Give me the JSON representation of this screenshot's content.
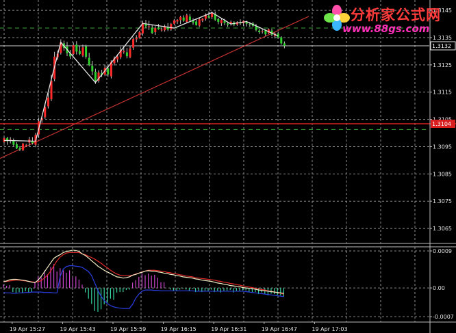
{
  "logo": {
    "name": "分析家公式网",
    "url": "www.88gs.com"
  },
  "chart_data": [
    {
      "type": "candlestick",
      "colors": {
        "up": "#ff2a2a",
        "down": "#2fd12f",
        "wick": "#c9c9c9",
        "grid": "#8c8c8c",
        "background": "#000000"
      },
      "grid": true,
      "y_ticks": [
        "1.3145",
        "1.3135",
        "1.3125",
        "1.3115",
        "1.3105",
        "1.3095",
        "1.3085",
        "1.3075",
        "1.3065"
      ],
      "ylim": [
        1.30595,
        1.31488
      ],
      "current_price_label": "1.3132",
      "current_price": 1.3132,
      "level_label": "1.3104",
      "level_price": 1.31034,
      "dashed_levels": [
        1.31385,
        1.31013
      ],
      "horizontal_lines": [
        1.3132
      ],
      "trend_line": {
        "from": [
          0,
          1.30912
        ],
        "to": [
          95,
          1.31418
        ],
        "color": "#c03030"
      },
      "zigzag": {
        "color": "#e6e6e6",
        "points": [
          [
            0,
            1.30973
          ],
          [
            10,
            1.3097
          ],
          [
            18,
            1.31333
          ],
          [
            29,
            1.31185
          ],
          [
            44,
            1.31402
          ],
          [
            54,
            1.31385
          ],
          [
            66,
            1.31442
          ],
          [
            72,
            1.314
          ],
          [
            77,
            1.31409
          ],
          [
            87,
            1.31356
          ]
        ]
      },
      "time_labels": [
        "19 Apr 15:27",
        "19 Apr 15:43",
        "19 Apr 15:59",
        "19 Apr 16:15",
        "19 Apr 16:31",
        "19 Apr 16:47",
        "19 Apr 17:03"
      ],
      "time_label_index": [
        3,
        19,
        35,
        51,
        67,
        83,
        99
      ],
      "candles": [
        [
          1.30967,
          1.30987,
          1.30962,
          1.30981
        ],
        [
          1.30982,
          1.30986,
          1.30957,
          1.3097
        ],
        [
          1.30971,
          1.30985,
          1.30962,
          1.30976
        ],
        [
          1.30972,
          1.3098,
          1.30952,
          1.30957
        ],
        [
          1.30959,
          1.30966,
          1.30941,
          1.30944
        ],
        [
          1.30945,
          1.30952,
          1.30934,
          1.30939
        ],
        [
          1.30937,
          1.30964,
          1.30934,
          1.30961
        ],
        [
          1.30952,
          1.3096,
          1.30949,
          1.30955
        ],
        [
          1.30965,
          1.30986,
          1.30953,
          1.30976
        ],
        [
          1.3097,
          1.30985,
          1.30958,
          1.30963
        ],
        [
          1.30957,
          1.31,
          1.30948,
          1.30993
        ],
        [
          1.30995,
          1.31057,
          1.30982,
          1.31043
        ],
        [
          1.31047,
          1.31062,
          1.31037,
          1.31054
        ],
        [
          1.31058,
          1.31109,
          1.31052,
          1.31095
        ],
        [
          1.31098,
          1.31147,
          1.3109,
          1.3113
        ],
        [
          1.31124,
          1.31214,
          1.31117,
          1.31192
        ],
        [
          1.31198,
          1.31298,
          1.3119,
          1.3128
        ],
        [
          1.31278,
          1.31303,
          1.31268,
          1.31291
        ],
        [
          1.31294,
          1.31344,
          1.31288,
          1.31333
        ],
        [
          1.31329,
          1.31339,
          1.31302,
          1.31312
        ],
        [
          1.31317,
          1.31334,
          1.31282,
          1.31293
        ],
        [
          1.31292,
          1.31305,
          1.31272,
          1.31281
        ],
        [
          1.3129,
          1.31332,
          1.31285,
          1.31322
        ],
        [
          1.31324,
          1.31337,
          1.31288,
          1.31299
        ],
        [
          1.31301,
          1.31321,
          1.31286,
          1.3129
        ],
        [
          1.31284,
          1.31324,
          1.31279,
          1.31314
        ],
        [
          1.31318,
          1.31324,
          1.31273,
          1.3128
        ],
        [
          1.31276,
          1.31294,
          1.31245,
          1.31249
        ],
        [
          1.31247,
          1.31265,
          1.31212,
          1.31226
        ],
        [
          1.31225,
          1.31236,
          1.3118,
          1.31192
        ],
        [
          1.31192,
          1.3123,
          1.31185,
          1.31222
        ],
        [
          1.3122,
          1.31232,
          1.31205,
          1.31213
        ],
        [
          1.31214,
          1.31251,
          1.31209,
          1.31239
        ],
        [
          1.31237,
          1.31248,
          1.31206,
          1.31215
        ],
        [
          1.31208,
          1.31267,
          1.312,
          1.31261
        ],
        [
          1.31256,
          1.31281,
          1.31248,
          1.31274
        ],
        [
          1.3127,
          1.31289,
          1.31259,
          1.31281
        ],
        [
          1.31278,
          1.31316,
          1.31271,
          1.31305
        ],
        [
          1.31297,
          1.3132,
          1.31291,
          1.31301
        ],
        [
          1.31296,
          1.31312,
          1.31274,
          1.31282
        ],
        [
          1.31278,
          1.3132,
          1.31274,
          1.3131
        ],
        [
          1.31313,
          1.3135,
          1.31305,
          1.31345
        ],
        [
          1.31344,
          1.31359,
          1.31333,
          1.31349
        ],
        [
          1.31349,
          1.31375,
          1.31346,
          1.3137
        ],
        [
          1.31365,
          1.31412,
          1.31357,
          1.31404
        ],
        [
          1.31402,
          1.31415,
          1.31385,
          1.31392
        ],
        [
          1.31388,
          1.31412,
          1.31378,
          1.31391
        ],
        [
          1.31386,
          1.31398,
          1.31363,
          1.31367
        ],
        [
          1.3137,
          1.31392,
          1.3136,
          1.31385
        ],
        [
          1.31387,
          1.314,
          1.31379,
          1.31381
        ],
        [
          1.31378,
          1.31387,
          1.31372,
          1.31379
        ],
        [
          1.31377,
          1.31398,
          1.31372,
          1.31392
        ],
        [
          1.31388,
          1.31403,
          1.31374,
          1.3138
        ],
        [
          1.31381,
          1.31404,
          1.31375,
          1.314
        ],
        [
          1.31401,
          1.31418,
          1.31396,
          1.31413
        ],
        [
          1.31409,
          1.31418,
          1.314,
          1.31415
        ],
        [
          1.31414,
          1.3143,
          1.314,
          1.31426
        ],
        [
          1.31424,
          1.31432,
          1.31408,
          1.31412
        ],
        [
          1.31408,
          1.31438,
          1.31404,
          1.31432
        ],
        [
          1.31427,
          1.31437,
          1.31409,
          1.31414
        ],
        [
          1.31413,
          1.31421,
          1.31397,
          1.31405
        ],
        [
          1.31409,
          1.31418,
          1.31394,
          1.31396
        ],
        [
          1.31394,
          1.31422,
          1.31389,
          1.31417
        ],
        [
          1.31413,
          1.31422,
          1.31407,
          1.31419
        ],
        [
          1.31419,
          1.31439,
          1.31412,
          1.31434
        ],
        [
          1.3143,
          1.31446,
          1.3142,
          1.31424
        ],
        [
          1.31425,
          1.31446,
          1.31418,
          1.3144
        ],
        [
          1.31437,
          1.31446,
          1.31411,
          1.31416
        ],
        [
          1.31418,
          1.31423,
          1.31399,
          1.31408
        ],
        [
          1.31403,
          1.3142,
          1.31393,
          1.31415
        ],
        [
          1.31411,
          1.31419,
          1.31396,
          1.31404
        ],
        [
          1.31402,
          1.31407,
          1.31389,
          1.31397
        ],
        [
          1.31401,
          1.31413,
          1.31394,
          1.31408
        ],
        [
          1.31406,
          1.3141,
          1.31392,
          1.31398
        ],
        [
          1.31398,
          1.3141,
          1.31393,
          1.31407
        ],
        [
          1.31406,
          1.31417,
          1.31396,
          1.31402
        ],
        [
          1.31403,
          1.31414,
          1.31393,
          1.31411
        ],
        [
          1.31407,
          1.31412,
          1.31391,
          1.31401
        ],
        [
          1.314,
          1.31407,
          1.3139,
          1.31399
        ],
        [
          1.31402,
          1.31408,
          1.31389,
          1.31393
        ],
        [
          1.31392,
          1.314,
          1.31373,
          1.31378
        ],
        [
          1.31376,
          1.31382,
          1.31363,
          1.3137
        ],
        [
          1.31373,
          1.31383,
          1.31365,
          1.31374
        ],
        [
          1.31377,
          1.3138,
          1.31356,
          1.31362
        ],
        [
          1.31367,
          1.31384,
          1.31363,
          1.3138
        ],
        [
          1.31376,
          1.31382,
          1.31355,
          1.31361
        ],
        [
          1.31356,
          1.31369,
          1.31347,
          1.31364
        ],
        [
          1.31365,
          1.31372,
          1.31346,
          1.3135
        ],
        [
          1.31351,
          1.31355,
          1.31324,
          1.31329
        ],
        [
          1.31329,
          1.31336,
          1.31311,
          1.3132
        ]
      ]
    },
    {
      "type": "indicator",
      "y_ticks": [
        "0.0009",
        "0.00",
        "-0.0007"
      ],
      "ylim": [
        -0.00083,
        0.001
      ],
      "colors": {
        "hist_pos": "#cc44cc",
        "hist_neg": "#36d6a2",
        "line1": "#f4eec6",
        "line2": "#e22a2a",
        "line3": "#2b3fe6"
      },
      "hist": [
        8e-05,
        5e-05,
        7e-05,
        -0.0001,
        -0.00012,
        -0.0001,
        -0.00012,
        -8e-05,
        -0.00012,
        -0.0001,
        0.00015,
        0.00028,
        0.00026,
        0.00042,
        0.00033,
        0.00051,
        0.00058,
        0.0004,
        0.00048,
        0.00043,
        0.00037,
        0.00043,
        0.00026,
        0.00028,
        0.0002,
        8e-05,
        -0.00011,
        -0.00026,
        -0.00039,
        -0.00056,
        -0.00058,
        -0.00052,
        -0.0004,
        -0.00036,
        -0.00026,
        -0.00029,
        -0.00011,
        -0.0001,
        -0.0001,
        -5e-05,
        -4e-05,
        0.00013,
        0.00019,
        0.00027,
        0.00035,
        0.00031,
        0.00035,
        0.0003,
        0.00032,
        0.00025,
        0.00014,
        0.00014,
        0.0,
        -4e-05,
        -7e-05,
        -7e-05,
        -4e-05,
        -2e-05,
        -4e-05,
        -8e-05,
        -3e-05,
        -0.0001,
        -8e-05,
        -0.0001,
        -7e-05,
        -8e-05,
        -4e-05,
        -0.0001,
        -7e-05,
        -0.00011,
        -7e-05,
        -7e-05,
        -5e-05,
        -0.00011,
        -7e-05,
        -7e-05,
        -6e-05,
        -6e-05,
        -9e-05,
        -0.00011,
        -0.0001,
        -0.00015,
        -0.00011,
        -0.00015,
        -0.00018,
        -0.00014,
        -0.00015,
        -0.00017,
        -0.00018,
        -0.00021
      ],
      "line1": [
        0.00015,
        0.00017,
        0.0002,
        0.00021,
        0.00021,
        0.0002,
        0.00019,
        0.00018,
        0.00016,
        0.00014,
        0.00013,
        0.00019,
        0.00028,
        0.00039,
        0.0005,
        0.00061,
        0.00072,
        0.00077,
        0.00081,
        0.00086,
        0.00089,
        0.0009,
        0.00092,
        0.00091,
        0.00089,
        0.00083,
        0.00079,
        0.00073,
        0.00066,
        0.0006,
        0.00053,
        0.00048,
        0.00043,
        0.00039,
        0.00035,
        0.00031,
        0.00027,
        0.00026,
        0.00024,
        0.00025,
        0.00027,
        0.00031,
        0.00033,
        0.00036,
        0.00038,
        0.00041,
        0.00042,
        0.00041,
        0.00041,
        0.00039,
        0.00038,
        0.00036,
        0.00035,
        0.00033,
        0.00032,
        0.0003,
        0.00029,
        0.00027,
        0.00026,
        0.00025,
        0.00024,
        0.00022,
        0.00021,
        0.00019,
        0.00018,
        0.00017,
        0.00016,
        0.00014,
        0.00012,
        0.00011,
        9e-05,
        8e-05,
        6e-05,
        5e-05,
        4e-05,
        3e-05,
        1e-05,
        0.0,
        -1e-05,
        -2e-05,
        -3e-05,
        -5e-05,
        -6e-05,
        -7e-05,
        -8e-05,
        -9e-05,
        -0.0001,
        -0.00011,
        -0.00012,
        -0.00013
      ],
      "line2": [
        0.00015,
        0.00016,
        0.00017,
        0.00018,
        0.00019,
        0.00019,
        0.00018,
        0.00017,
        0.00016,
        0.00015,
        0.00014,
        0.00015,
        0.00018,
        0.00024,
        0.00031,
        0.00041,
        0.00054,
        0.00066,
        0.00075,
        0.00081,
        0.00085,
        0.00086,
        0.00086,
        0.00086,
        0.00086,
        0.00083,
        0.00081,
        0.00077,
        0.00074,
        0.0007,
        0.00065,
        0.0006,
        0.00054,
        0.00049,
        0.00043,
        0.00038,
        0.00034,
        0.00031,
        0.0003,
        0.0003,
        0.0003,
        0.00031,
        0.00034,
        0.00036,
        0.00039,
        0.00041,
        0.00043,
        0.00043,
        0.00043,
        0.00042,
        0.00041,
        0.0004,
        0.00038,
        0.00037,
        0.00035,
        0.00034,
        0.00032,
        0.00031,
        0.00029,
        0.00028,
        0.00027,
        0.00025,
        0.00024,
        0.00023,
        0.00022,
        0.00021,
        0.0002,
        0.00019,
        0.00017,
        0.00016,
        0.00014,
        0.00013,
        0.00011,
        0.0001,
        8e-05,
        7e-05,
        5e-05,
        4e-05,
        2e-05,
        1e-05,
        -1e-05,
        -2e-05,
        -4e-05,
        -5e-05,
        -7e-05,
        -8e-05,
        -0.0001,
        -0.00011,
        -0.00013,
        -0.00015
      ],
      "line3": [
        -0.00011,
        -0.00012,
        -0.00012,
        -0.00013,
        -0.00013,
        -0.00012,
        -0.00012,
        -0.00011,
        -0.00011,
        -0.0001,
        -0.0001,
        -0.0001,
        -0.0001,
        -0.00011,
        -0.00011,
        -0.00011,
        -0.00012,
        -0.00012,
        0.00028,
        0.00046,
        0.00052,
        0.00054,
        0.00054,
        0.00053,
        0.00052,
        0.0005,
        0.00045,
        0.0004,
        0.0003,
        0.00012,
        -6e-05,
        -0.0002,
        -0.00031,
        -0.00038,
        -0.00043,
        -0.00046,
        -0.00048,
        -0.00049,
        -0.0005,
        -0.0005,
        -0.0005,
        -0.0004,
        -0.00025,
        -0.00015,
        -8e-05,
        -5e-05,
        -5e-05,
        -5e-05,
        -6e-05,
        -6e-05,
        -7e-05,
        -7e-05,
        -7e-05,
        -7e-05,
        -7e-05,
        -7e-05,
        -7e-05,
        -7e-05,
        -7e-05,
        -7e-05,
        -7e-05,
        -8e-05,
        -8e-05,
        -8e-05,
        -8e-05,
        -8e-05,
        -8e-05,
        -8e-05,
        -8e-05,
        -8e-05,
        -8e-05,
        -8e-05,
        -8e-05,
        -8e-05,
        -8e-05,
        -8e-05,
        -8e-05,
        -9e-05,
        -0.0001,
        -0.00011,
        -0.00012,
        -0.00013,
        -0.00014,
        -0.00015,
        -0.00016,
        -0.00017,
        -0.00018,
        -0.00019,
        -0.0002,
        -0.00021
      ]
    }
  ]
}
